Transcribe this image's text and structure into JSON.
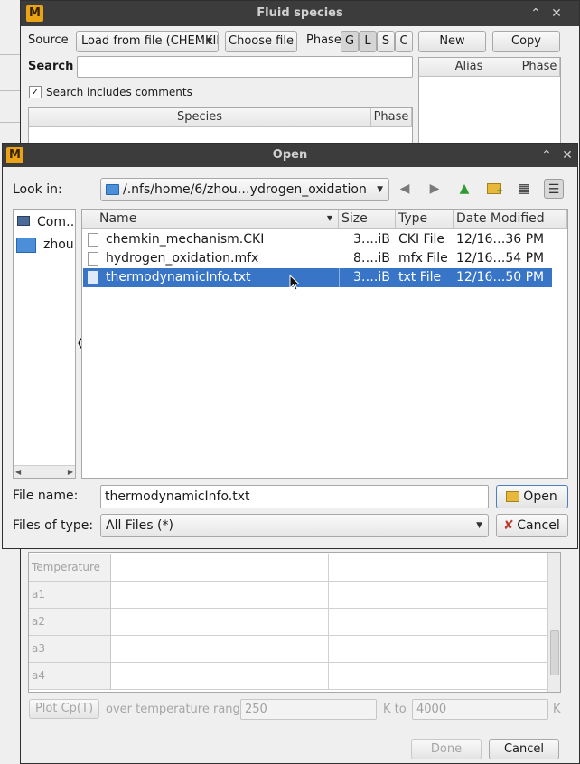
{
  "parent_dialog": {
    "title": "Fluid species",
    "source_label": "Source",
    "source_value": "Load from file (CHEMKIN)",
    "choose_file_label": "Choose file",
    "phase_label": "Phase",
    "phase_buttons": [
      "G",
      "L",
      "S",
      "C"
    ],
    "new_label": "New",
    "copy_label": "Copy",
    "search_label": "Search",
    "search_value": "",
    "search_comments_label": "Search includes comments",
    "species_col": "Species",
    "phase_col": "Phase",
    "alias_col": "Alias",
    "alias_phase_col": "Phase",
    "params": [
      "Temperature",
      "a1",
      "a2",
      "a3",
      "a4"
    ],
    "plot_label": "Plot Cp(T)",
    "range_label": "over temperature range",
    "t_from": "250",
    "k_to_label": "K to",
    "t_to": "4000",
    "k_label": "K",
    "done_label": "Done",
    "cancel_label": "Cancel"
  },
  "open_dialog": {
    "title": "Open",
    "look_in_label": "Look in:",
    "path": "/.nfs/home/6/zhou…ydrogen_oxidation",
    "sidebar": [
      "Com…",
      "zhou"
    ],
    "columns": {
      "name": "Name",
      "size": "Size",
      "type": "Type",
      "date": "Date Modified"
    },
    "files": [
      {
        "name": "chemkin_mechanism.CKI",
        "size": "3….iB",
        "type": "CKI File",
        "date": "12/16…36 PM"
      },
      {
        "name": "hydrogen_oxidation.mfx",
        "size": "8….iB",
        "type": "mfx File",
        "date": "12/16…54 PM"
      },
      {
        "name": "thermodynamicInfo.txt",
        "size": "3….iB",
        "type": "txt File",
        "date": "12/16…50 PM"
      }
    ],
    "selected_index": 2,
    "file_name_label": "File name:",
    "file_name_value": "thermodynamicInfo.txt",
    "files_of_type_label": "Files of type:",
    "files_of_type_value": "All Files (*)",
    "open_label": "Open",
    "cancel_label": "Cancel"
  },
  "colors": {
    "accent": "#3875c6",
    "logo": "#e8a317",
    "titlebar": "#3c3c3c"
  },
  "icons": [
    "app-logo-icon",
    "back-icon",
    "forward-icon",
    "parent-dir-icon",
    "new-folder-icon",
    "list-view-icon",
    "detail-view-icon",
    "folder-icon",
    "computer-icon",
    "file-icon",
    "checkbox-checked-icon",
    "close-icon",
    "minimize-icon"
  ]
}
